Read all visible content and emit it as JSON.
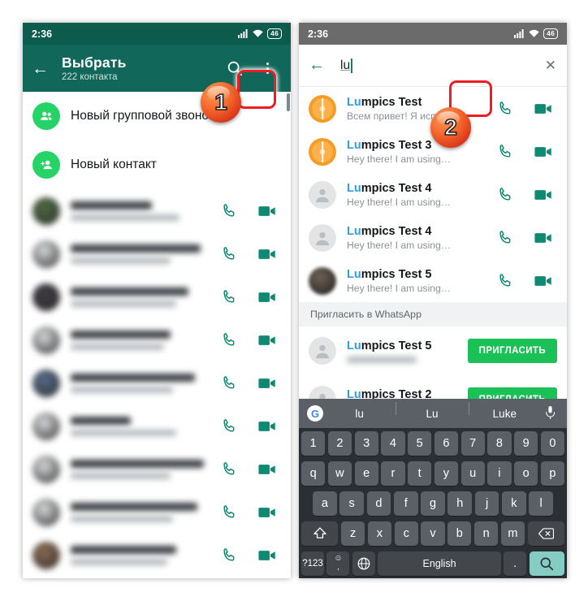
{
  "left": {
    "status": {
      "time": "2:36",
      "battery": "46",
      "signal_icon": "signal-bars-icon",
      "wifi_icon": "wifi-icon"
    },
    "appbar": {
      "back_icon": "back-arrow-icon",
      "title": "Выбрать",
      "subtitle": "222 контакта",
      "search_icon": "search-icon",
      "overflow_icon": "more-vert-icon"
    },
    "actions": [
      {
        "label": "Новый групповой звонок",
        "icon": "group-call-icon"
      },
      {
        "label": "Новый контакт",
        "icon": "add-contact-icon"
      }
    ],
    "contacts_blurred": 9
  },
  "right": {
    "status": {
      "time": "2:36",
      "battery": "46",
      "signal_icon": "signal-bars-icon",
      "wifi_icon": "wifi-icon"
    },
    "search": {
      "back_icon": "back-arrow-icon",
      "value": "lu",
      "clear_icon": "close-icon"
    },
    "results": [
      {
        "name_hl": "Lu",
        "name_rest": "mpics Test",
        "status": "Всем привет! Я испо…",
        "avatar": "orange-avatar"
      },
      {
        "name_hl": "Lu",
        "name_rest": "mpics Test 3",
        "status": "Hey there! I am using…",
        "avatar": "orange-avatar"
      },
      {
        "name_hl": "Lu",
        "name_rest": "mpics Test 4",
        "status": "Hey there! I am using…",
        "avatar": "default-avatar"
      },
      {
        "name_hl": "Lu",
        "name_rest": "mpics Test 4",
        "status": "Hey there! I am using…",
        "avatar": "default-avatar"
      },
      {
        "name_hl": "Lu",
        "name_rest": "mpics Test 5",
        "status": "Hey there! I am using…",
        "avatar": "photo-avatar"
      }
    ],
    "invite_section": {
      "header": "Пригласить в WhatsApp",
      "rows": [
        {
          "name_hl": "Lu",
          "name_rest": "mpics Test 5",
          "button": "ПРИГЛАСИТЬ"
        },
        {
          "name_hl": "Lu",
          "name_rest": "mpics Test 2",
          "button": "ПРИГЛАСИТЬ"
        }
      ]
    },
    "keyboard": {
      "google_logo": "google-g-icon",
      "suggestions": [
        "lu",
        "Lu",
        "Luke"
      ],
      "mic_icon": "microphone-icon",
      "row_numbers": [
        "1",
        "2",
        "3",
        "4",
        "5",
        "6",
        "7",
        "8",
        "9",
        "0"
      ],
      "row_q": [
        "q",
        "w",
        "e",
        "r",
        "t",
        "y",
        "u",
        "i",
        "o",
        "p"
      ],
      "row_a": [
        "a",
        "s",
        "d",
        "f",
        "g",
        "h",
        "j",
        "k",
        "l"
      ],
      "row_z": [
        "z",
        "x",
        "c",
        "v",
        "b",
        "n",
        "m"
      ],
      "shift_icon": "shift-icon",
      "backspace_icon": "backspace-icon",
      "symbols_key": "?123",
      "emoji_key": "☺",
      "comma_key": ",",
      "globe_icon": "globe-icon",
      "space_label": "English",
      "period_key": ".",
      "search_key_icon": "search-icon"
    }
  },
  "annotations": [
    {
      "name": "callout-badge-1",
      "number": "1"
    },
    {
      "name": "callout-badge-2",
      "number": "2"
    }
  ],
  "colors": {
    "appbar_green": "#11685a",
    "statusbar_dark": "#0c5b4c",
    "whatsapp_green": "#25d366",
    "teal_icon": "#0f8a72",
    "highlight_blue": "#2f9fe0",
    "annotation_red": "#ee1c25"
  }
}
